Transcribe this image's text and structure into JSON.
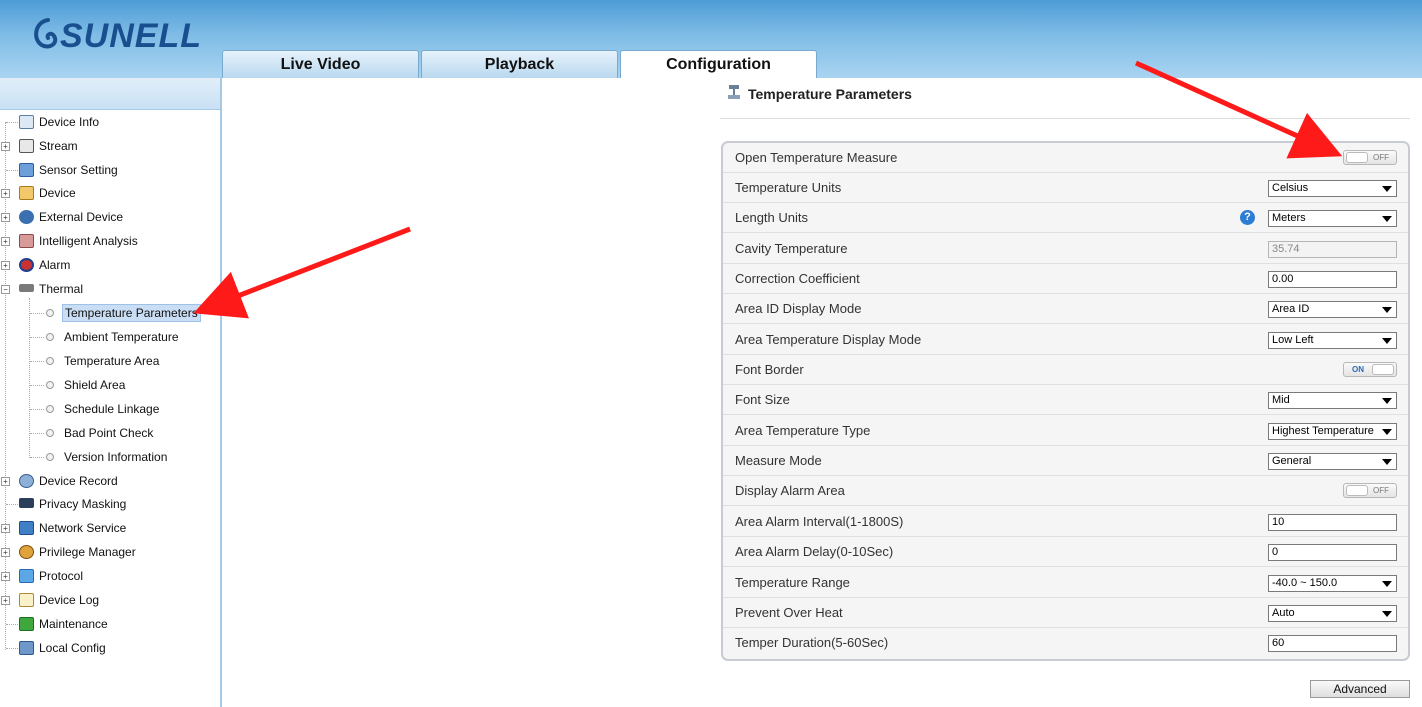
{
  "brand": {
    "logo_text": "SUNELL"
  },
  "tabs": [
    {
      "label": "Live Video"
    },
    {
      "label": "Playback"
    },
    {
      "label": "Configuration"
    }
  ],
  "sidebar": {
    "items": [
      {
        "label": "Device Info",
        "icon": "document-icon"
      },
      {
        "label": "Stream",
        "icon": "stream-icon"
      },
      {
        "label": "Sensor Setting",
        "icon": "sensor-icon"
      },
      {
        "label": "Device",
        "icon": "device-icon"
      },
      {
        "label": "External Device",
        "icon": "external-device-icon"
      },
      {
        "label": "Intelligent Analysis",
        "icon": "analysis-icon"
      },
      {
        "label": "Alarm",
        "icon": "alarm-icon"
      },
      {
        "label": "Thermal",
        "icon": "thermal-camera-icon"
      },
      {
        "label": "Device Record",
        "icon": "record-icon"
      },
      {
        "label": "Privacy Masking",
        "icon": "privacy-icon"
      },
      {
        "label": "Network Service",
        "icon": "network-icon"
      },
      {
        "label": "Privilege Manager",
        "icon": "users-icon"
      },
      {
        "label": "Protocol",
        "icon": "protocol-icon"
      },
      {
        "label": "Device Log",
        "icon": "log-icon"
      },
      {
        "label": "Maintenance",
        "icon": "maintenance-icon"
      },
      {
        "label": "Local Config",
        "icon": "local-config-icon"
      }
    ],
    "thermal_children": [
      {
        "label": "Temperature Parameters"
      },
      {
        "label": "Ambient Temperature"
      },
      {
        "label": "Temperature Area"
      },
      {
        "label": "Shield Area"
      },
      {
        "label": "Schedule Linkage"
      },
      {
        "label": "Bad Point Check"
      },
      {
        "label": "Version Information"
      }
    ]
  },
  "page": {
    "title": "Temperature Parameters"
  },
  "form": {
    "rows": [
      {
        "label": "Open Temperature Measure",
        "type": "toggle",
        "value": "OFF"
      },
      {
        "label": "Temperature Units",
        "type": "select",
        "value": "Celsius"
      },
      {
        "label": "Length Units",
        "type": "select",
        "value": "Meters",
        "help": "?"
      },
      {
        "label": "Cavity Temperature",
        "type": "input-disabled",
        "value": "35.74"
      },
      {
        "label": "Correction Coefficient",
        "type": "input",
        "value": "0.00"
      },
      {
        "label": "Area ID Display Mode",
        "type": "select",
        "value": "Area ID"
      },
      {
        "label": "Area Temperature Display Mode",
        "type": "select",
        "value": "Low Left"
      },
      {
        "label": "Font Border",
        "type": "toggle",
        "value": "ON"
      },
      {
        "label": "Font Size",
        "type": "select",
        "value": "Mid"
      },
      {
        "label": "Area Temperature Type",
        "type": "select",
        "value": "Highest Temperature"
      },
      {
        "label": "Measure Mode",
        "type": "select",
        "value": "General"
      },
      {
        "label": "Display Alarm Area",
        "type": "toggle",
        "value": "OFF"
      },
      {
        "label": "Area Alarm Interval(1-1800S)",
        "type": "input",
        "value": "10"
      },
      {
        "label": "Area Alarm Delay(0-10Sec)",
        "type": "input",
        "value": "0"
      },
      {
        "label": "Temperature Range",
        "type": "select",
        "value": "-40.0 ~ 150.0"
      },
      {
        "label": "Prevent Over Heat",
        "type": "select",
        "value": "Auto"
      },
      {
        "label": "Temper Duration(5-60Sec)",
        "type": "input",
        "value": "60"
      }
    ]
  },
  "buttons": {
    "advanced": "Advanced"
  },
  "colors": {
    "header": "#7fbce6",
    "accent": "#2e7dd4",
    "annotation_arrow": "#ff0000"
  }
}
